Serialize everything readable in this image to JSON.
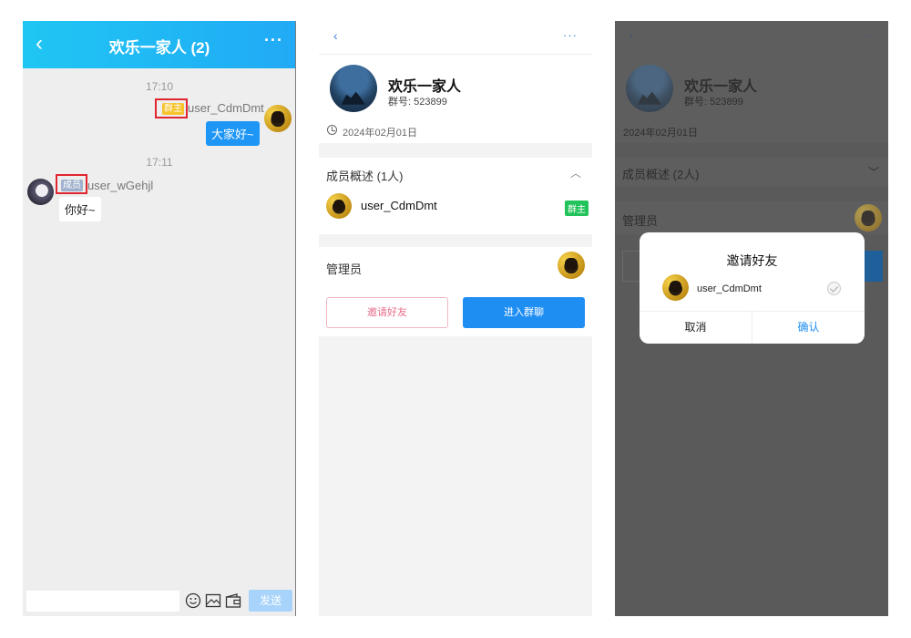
{
  "chat": {
    "title": "欢乐一家人 (2)",
    "back_icon": "chevron-left-icon",
    "more_icon": "more-dots-icon",
    "time_1": "17:10",
    "owner_tag": "群主",
    "owner_name": "user_CdmDmt",
    "owner_message": "大家好~",
    "time_2": "17:11",
    "member_tag": "成员",
    "member_name": "user_wGehjl",
    "member_message": "你好~",
    "send_label": "发送",
    "tool_icons": [
      "emoji-icon",
      "image-icon",
      "wallet-icon"
    ]
  },
  "detail": {
    "group_name": "欢乐一家人",
    "group_no": "群号: 523899",
    "created_date": "2024年02月01日",
    "members_title": "成员概述 (1人)",
    "member_name": "user_CdmDmt",
    "owner_badge": "群主",
    "admins_title": "管理员",
    "invite_label": "邀请好友",
    "enter_label": "进入群聊"
  },
  "dialog_panel": {
    "group_name": "欢乐一家人",
    "group_no": "群号: 523899",
    "created_date": "2024年02月01日",
    "members_title": "成员概述 (2人)",
    "admins_title": "管理员",
    "dialog_title": "邀请好友",
    "dialog_member": "user_CdmDmt",
    "cancel_label": "取消",
    "confirm_label": "确认"
  },
  "colors": {
    "header_gradient_start": "#1fc6f3",
    "header_gradient_end": "#21aaf5",
    "primary_blue": "#1f8ef3",
    "owner_tag": "#f6c32c",
    "member_tag": "#9fb1cc",
    "green_badge": "#22c35a",
    "highlight_box": "#e0262f"
  }
}
